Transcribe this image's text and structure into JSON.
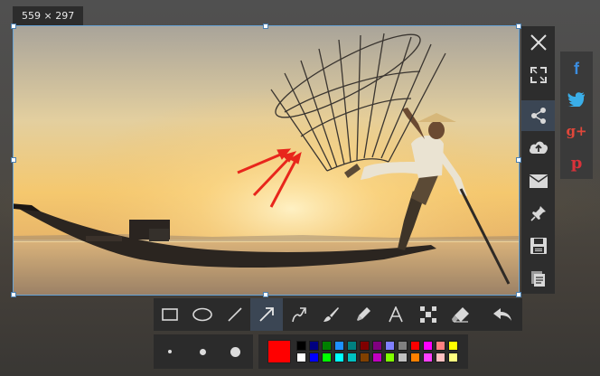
{
  "selection": {
    "size_text": "559 × 297"
  },
  "side_toolbar": {
    "items": [
      {
        "icon": "close-icon",
        "name": "close-button"
      },
      {
        "icon": "fullscreen-icon",
        "name": "fullscreen-button"
      },
      {
        "icon": "share-icon",
        "name": "share-button",
        "active": true
      },
      {
        "icon": "cloud-upload-icon",
        "name": "upload-button"
      },
      {
        "icon": "mail-icon",
        "name": "email-button"
      },
      {
        "icon": "pin-icon",
        "name": "pin-button"
      },
      {
        "icon": "save-icon",
        "name": "save-button"
      },
      {
        "icon": "copy-icon",
        "name": "copy-button"
      }
    ]
  },
  "social": {
    "items": [
      {
        "label": "f",
        "color": "#3b8de0",
        "name": "facebook-button"
      },
      {
        "label": "twitter",
        "color": "#3aaee8",
        "name": "twitter-button"
      },
      {
        "label": "g+",
        "color": "#e0473a",
        "name": "google-plus-button"
      },
      {
        "label": "p",
        "color": "#d9323a",
        "name": "pinterest-button"
      }
    ]
  },
  "draw_toolbar": {
    "tools": [
      {
        "icon": "rectangle-icon",
        "name": "rectangle-tool"
      },
      {
        "icon": "ellipse-icon",
        "name": "ellipse-tool"
      },
      {
        "icon": "line-icon",
        "name": "line-tool"
      },
      {
        "icon": "arrow-icon",
        "name": "arrow-tool",
        "active": true
      },
      {
        "icon": "curved-arrow-icon",
        "name": "curved-arrow-tool"
      },
      {
        "icon": "brush-icon",
        "name": "brush-tool"
      },
      {
        "icon": "marker-icon",
        "name": "marker-tool"
      },
      {
        "icon": "text-icon",
        "name": "text-tool"
      },
      {
        "icon": "mosaic-icon",
        "name": "blur-tool"
      },
      {
        "icon": "eraser-icon",
        "name": "eraser-tool"
      }
    ],
    "undo_icon": "undo-icon"
  },
  "stroke_sizes": [
    "small",
    "medium",
    "large"
  ],
  "palette": {
    "current_color": "#ff0000",
    "colors": [
      "#000000",
      "#000080",
      "#008000",
      "#1e90ff",
      "#008080",
      "#800000",
      "#800080",
      "#8080ff",
      "#808080",
      "#ff0000",
      "#ff00ff",
      "#ff8080",
      "#ffff00",
      "#ffffff",
      "#0000ff",
      "#00ff00",
      "#00ffff",
      "#00c0c0",
      "#804000",
      "#c000c0",
      "#80ff00",
      "#c0c0c0",
      "#ff8000",
      "#ff40ff",
      "#ffc0c0",
      "#ffff80"
    ]
  }
}
